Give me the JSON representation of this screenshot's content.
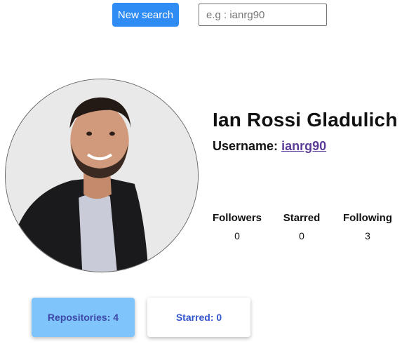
{
  "search": {
    "button_label": "New search",
    "placeholder": "e.g : ianrg90",
    "value": ""
  },
  "profile": {
    "full_name": "Ian Rossi Gladulich",
    "username_label": "Username:",
    "username": "ianrg90"
  },
  "stats": [
    {
      "label": "Followers",
      "value": "0"
    },
    {
      "label": "Starred",
      "value": "0"
    },
    {
      "label": "Following",
      "value": "3"
    }
  ],
  "tabs": {
    "repositories": "Repositories: 4",
    "starred": "Starred: 0"
  },
  "colors": {
    "primary_button": "#2f8cf5",
    "active_tab": "#7fc4fb",
    "link": "#5b3d99"
  }
}
